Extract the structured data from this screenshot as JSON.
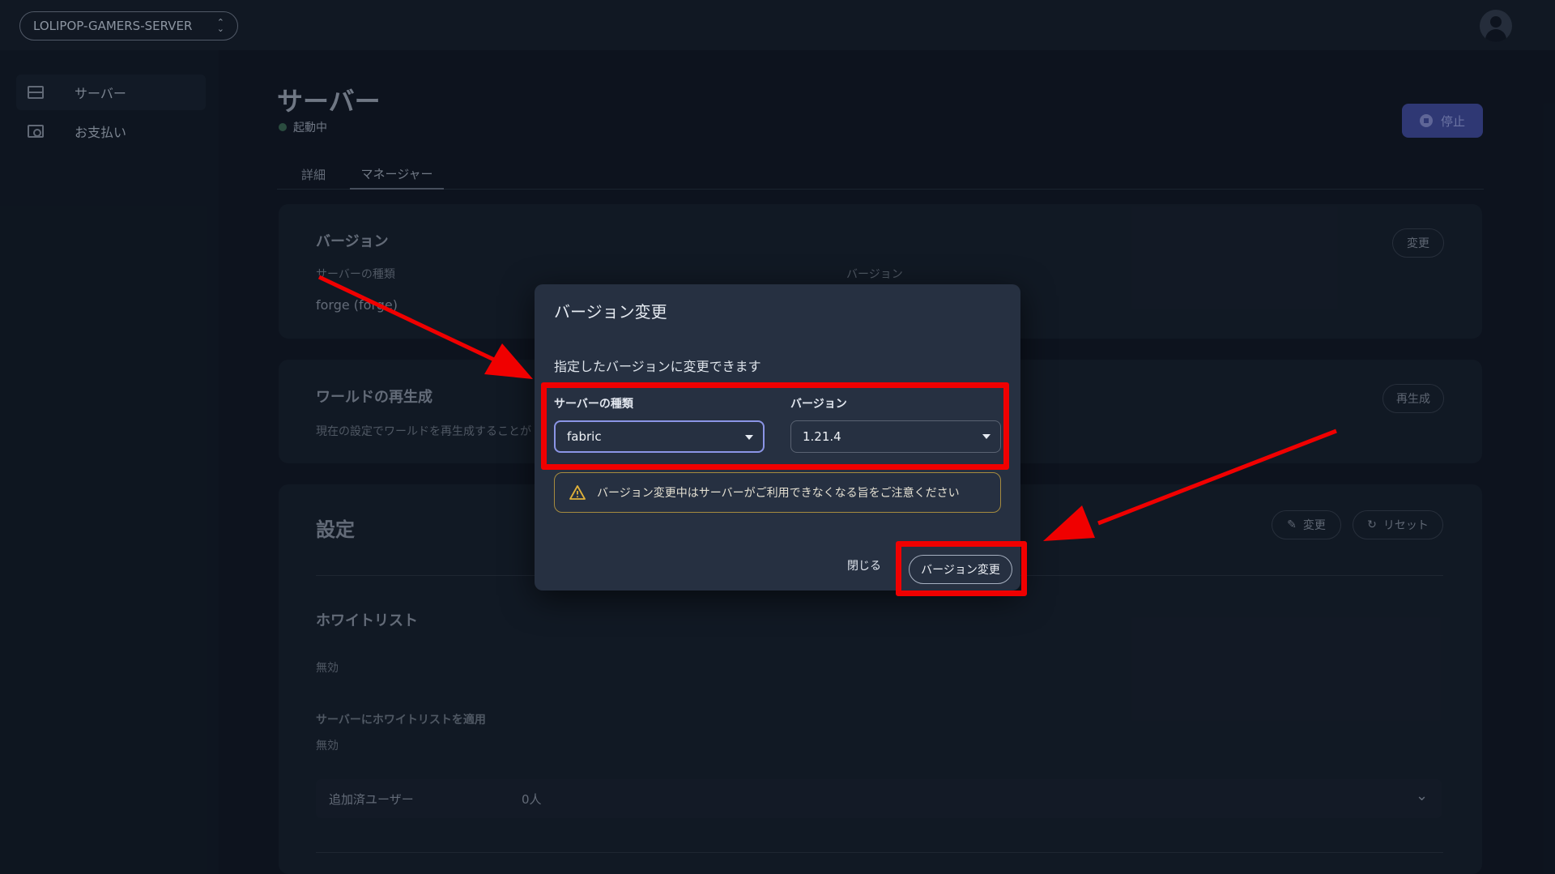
{
  "topbar": {
    "server_name": "LOLIPOP-GAMERS-SERVER",
    "switch_glyph": "⌃⌄"
  },
  "sidebar": {
    "items": [
      {
        "label": "サーバー",
        "icon": "server-icon"
      },
      {
        "label": "お支払い",
        "icon": "payment-icon"
      }
    ]
  },
  "page": {
    "title": "サーバー",
    "status": "起動中",
    "stop_label": "停止"
  },
  "tabs": [
    {
      "label": "詳細"
    },
    {
      "label": "マネージャー"
    }
  ],
  "version_card": {
    "title": "バージョン",
    "type_label": "サーバーの種類",
    "type_value": "forge (forge)",
    "version_label": "バージョン",
    "change_label": "変更"
  },
  "world_card": {
    "title": "ワールドの再生成",
    "desc": "現在の設定でワールドを再生成することが",
    "regen_label": "再生成"
  },
  "settings": {
    "title": "設定",
    "edit_label": "変更",
    "reset_label": "リセット",
    "whitelist_title": "ホワイトリスト",
    "whitelist_value": "無効",
    "apply_label": "サーバーにホワイトリストを適用",
    "apply_value": "無効",
    "users_label": "追加済ユーザー",
    "users_count": "0人"
  },
  "dialog": {
    "title": "バージョン変更",
    "description": "指定したバージョンに変更できます",
    "server_type_label": "サーバーの種類",
    "server_type_value": "fabric",
    "version_label": "バージョン",
    "version_value": "1.21.4",
    "warning": "バージョン変更中はサーバーがご利用できなくなる旨をご注意ください",
    "close_label": "閉じる",
    "confirm_label": "バージョン変更"
  },
  "colors": {
    "annotation": "#f00000",
    "accent": "#8b95e6",
    "warning": "#e0b13a"
  }
}
